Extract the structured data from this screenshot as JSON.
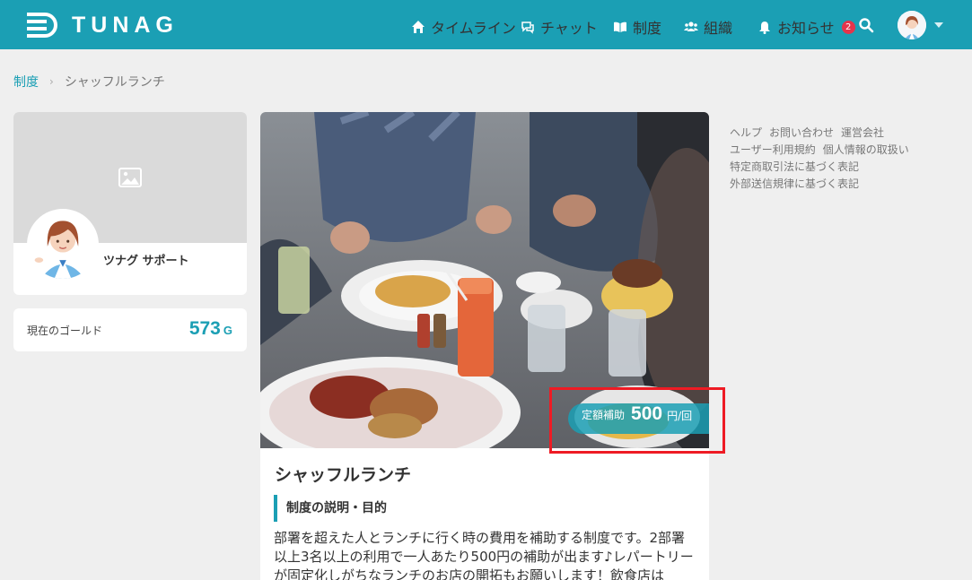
{
  "header": {
    "brand": "TUNAG",
    "nav": [
      {
        "label": "タイムライン",
        "icon": "home-icon"
      },
      {
        "label": "チャット",
        "icon": "chat-icon"
      },
      {
        "label": "制度",
        "icon": "book-icon"
      },
      {
        "label": "組織",
        "icon": "users-icon"
      },
      {
        "label": "お知らせ",
        "icon": "bell-icon",
        "badge": "2"
      }
    ],
    "search_icon": "search-icon"
  },
  "breadcrumb": {
    "parent": "制度",
    "current": "シャッフルランチ"
  },
  "profile": {
    "name": "ツナグ サポート"
  },
  "gold": {
    "label": "現在のゴールド",
    "value": "573",
    "unit": "G"
  },
  "program": {
    "subsidy_label": "定額補助",
    "subsidy_value": "500",
    "subsidy_unit": "円/回",
    "title": "シャッフルランチ",
    "section_heading": "制度の説明・目的",
    "description": "部署を超えた人とランチに行く時の費用を補助する制度です。2部署以上3名以上の利用で一人あたり500円の補助が出ます♪レパートリーが固定化しがちなランチのお店の開拓もお願いします！飲食店は"
  },
  "footer_links": {
    "row1": [
      "ヘルプ",
      "お問い合わせ",
      "運営会社"
    ],
    "row2": [
      "ユーザー利用規約",
      "個人情報の取扱い"
    ],
    "row3": [
      "特定商取引法に基づく表記"
    ],
    "row4": [
      "外部送信規律に基づく表記"
    ]
  },
  "colors": {
    "brand": "#1b9fb4",
    "badge": "#e5344b",
    "highlight": "#ee1b24"
  }
}
